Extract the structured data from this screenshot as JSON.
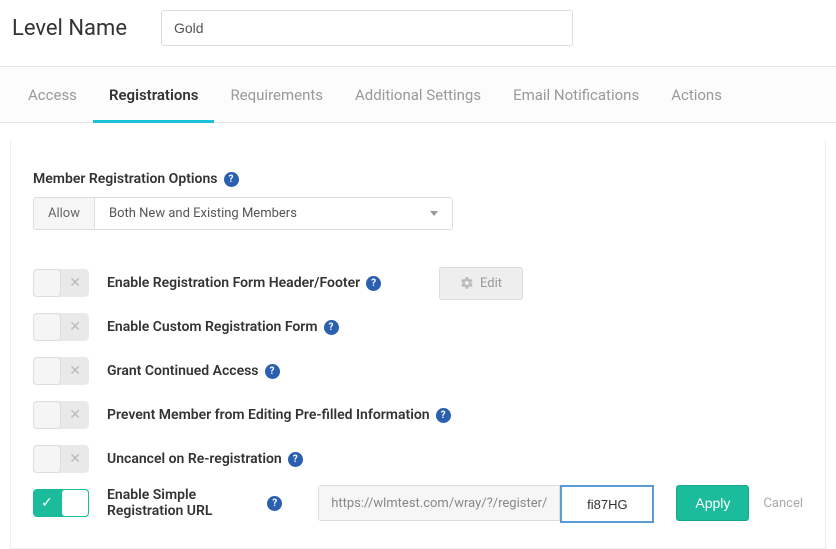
{
  "header": {
    "label": "Level Name",
    "value": "Gold"
  },
  "tabs": [
    {
      "label": "Access",
      "active": false
    },
    {
      "label": "Registrations",
      "active": true
    },
    {
      "label": "Requirements",
      "active": false
    },
    {
      "label": "Additional Settings",
      "active": false
    },
    {
      "label": "Email Notifications",
      "active": false
    },
    {
      "label": "Actions",
      "active": false
    }
  ],
  "section": {
    "title": "Member Registration Options",
    "allow_label": "Allow",
    "allow_value": "Both New and Existing Members"
  },
  "options": {
    "header_footer": {
      "label": "Enable Registration Form Header/Footer",
      "on": false
    },
    "custom_form": {
      "label": "Enable Custom Registration Form",
      "on": false
    },
    "continued": {
      "label": "Grant Continued Access",
      "on": false
    },
    "prevent_edit": {
      "label": "Prevent Member from Editing Pre-filled Information",
      "on": false
    },
    "uncancel": {
      "label": "Uncancel on Re-registration",
      "on": false
    },
    "simple_url": {
      "label": "Enable Simple Registration URL",
      "on": true
    }
  },
  "edit_button_label": "Edit",
  "url": {
    "prefix": "https://wlmtest.com/wray/?/register/",
    "value": "fi87HG"
  },
  "actions": {
    "apply": "Apply",
    "cancel": "Cancel"
  }
}
